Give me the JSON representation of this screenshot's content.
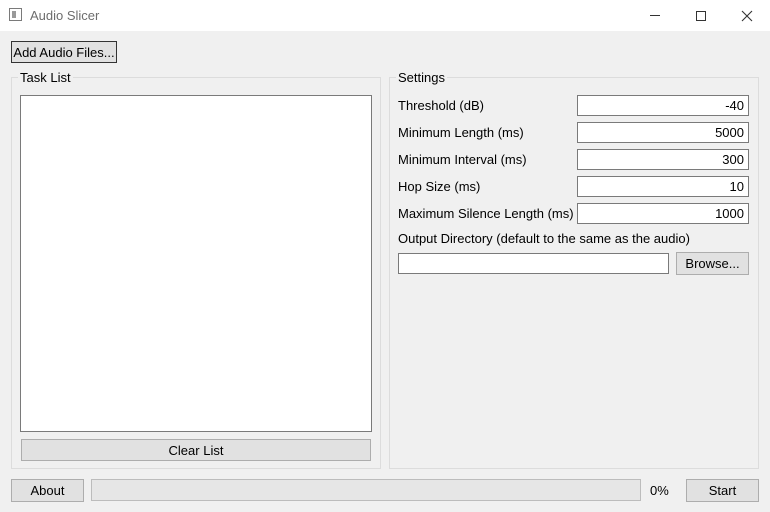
{
  "window": {
    "title": "Audio Slicer"
  },
  "toolbar": {
    "add_files_label": "Add Audio Files..."
  },
  "task_list": {
    "title": "Task List",
    "clear_label": "Clear List"
  },
  "settings": {
    "title": "Settings",
    "threshold": {
      "label": "Threshold (dB)",
      "value": "-40"
    },
    "min_length": {
      "label": "Minimum Length (ms)",
      "value": "5000"
    },
    "min_interval": {
      "label": "Minimum Interval (ms)",
      "value": "300"
    },
    "hop_size": {
      "label": "Hop Size (ms)",
      "value": "10"
    },
    "max_silence": {
      "label": "Maximum Silence Length (ms)",
      "value": "1000"
    },
    "output_dir": {
      "label": "Output Directory (default to the same as the audio)",
      "value": "",
      "browse_label": "Browse..."
    }
  },
  "footer": {
    "about_label": "About",
    "progress_text": "0%",
    "progress_value": 0,
    "start_label": "Start"
  }
}
